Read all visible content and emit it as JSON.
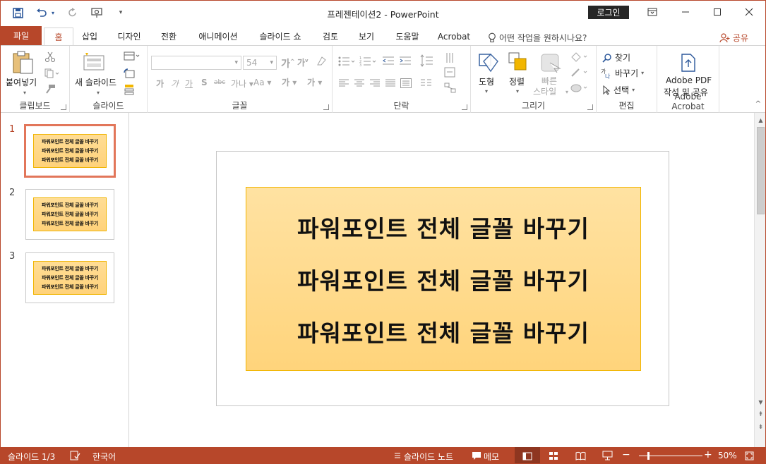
{
  "window": {
    "title": "프레젠테이션2  -  PowerPoint",
    "login_label": "로그인"
  },
  "qat": {
    "save_icon": "save-icon",
    "undo_icon": "undo-icon",
    "redo_icon": "redo-icon",
    "present_icon": "present-from-start-icon",
    "customize_icon": "customize-qat-icon"
  },
  "tabs": [
    {
      "label": "파일"
    },
    {
      "label": "홈"
    },
    {
      "label": "삽입"
    },
    {
      "label": "디자인"
    },
    {
      "label": "전환"
    },
    {
      "label": "애니메이션"
    },
    {
      "label": "슬라이드 쇼"
    },
    {
      "label": "검토"
    },
    {
      "label": "보기"
    },
    {
      "label": "도움말"
    },
    {
      "label": "Acrobat"
    }
  ],
  "tell_me": "어떤 작업을 원하시나요?",
  "share": "공유",
  "ribbon": {
    "clipboard": {
      "paste": "붙여넣기",
      "label": "클립보드"
    },
    "slides": {
      "new_slide": "새 슬라이드",
      "label": "슬라이드"
    },
    "font": {
      "font_size": "54",
      "label": "글꼴"
    },
    "paragraph": {
      "label": "단락"
    },
    "drawing": {
      "shapes": "도형",
      "arrange": "정렬",
      "quick_styles_1": "빠른",
      "quick_styles_2": "스타일",
      "label": "그리기"
    },
    "editing": {
      "find": "찾기",
      "replace": "바꾸기",
      "select": "선택",
      "label": "편집"
    },
    "acrobat": {
      "create_1": "Adobe PDF",
      "create_2": "작성 및 공유",
      "label": "Adobe Acrobat"
    }
  },
  "thumbnails": [
    {
      "num": "1",
      "lines": [
        "파워포인트 전체 글꼴 바꾸기",
        "파워포인트 전체 글꼴 바꾸기",
        "파워포인트 전체 글꼴 바꾸기"
      ]
    },
    {
      "num": "2",
      "lines": [
        "파워포인트 전체 글꼴 바꾸기",
        "파워포인트 전체 글꼴 바꾸기",
        "파워포인트 전체 글꼴 바꾸기"
      ]
    },
    {
      "num": "3",
      "lines": [
        "파워포인트 전체 글꼴 바꾸기",
        "파워포인트 전체 글꼴 바꾸기",
        "파워포인트 전체 글꼴 바꾸기"
      ]
    }
  ],
  "slide": {
    "lines": [
      "파워포인트 전체 글꼴 바꾸기",
      "파워포인트 전체 글꼴 바꾸기",
      "파워포인트 전체 글꼴 바꾸기"
    ]
  },
  "status": {
    "slide_count": "슬라이드 1/3",
    "language": "한국어",
    "notes": "슬라이드 노트",
    "comments": "메모",
    "zoom": "50%"
  },
  "colors": {
    "accent": "#b7472a",
    "box_fill": "#ffd47b",
    "box_border": "#f1b500"
  }
}
